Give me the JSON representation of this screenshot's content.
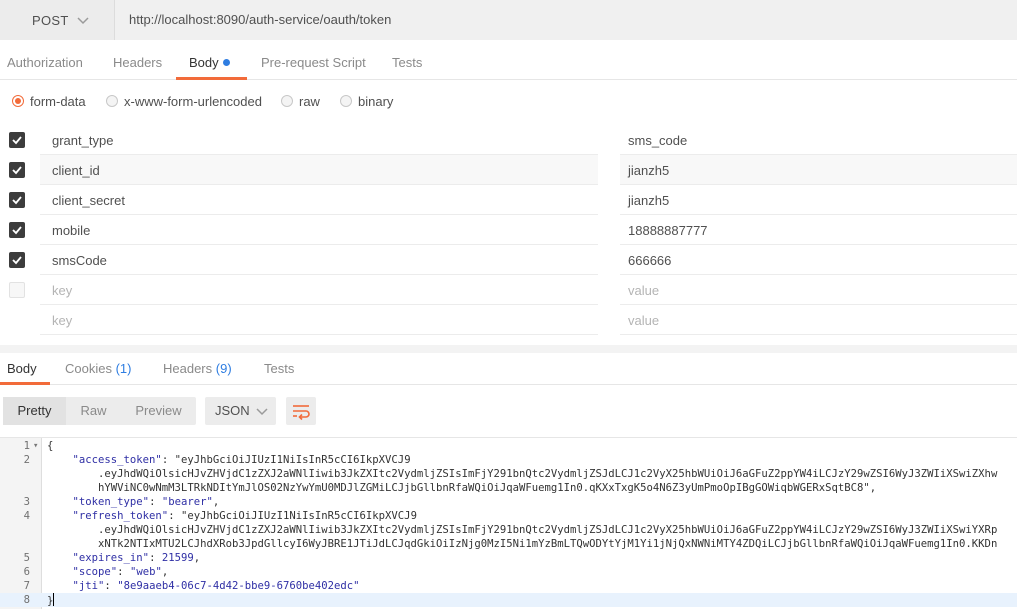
{
  "request": {
    "method": "POST",
    "url": "http://localhost:8090/auth-service/oauth/token"
  },
  "request_tabs": [
    {
      "label": "Authorization"
    },
    {
      "label": "Headers"
    },
    {
      "label": "Body"
    },
    {
      "label": "Pre-request Script"
    },
    {
      "label": "Tests"
    }
  ],
  "body_types": [
    {
      "label": "form-data",
      "checked": true
    },
    {
      "label": "x-www-form-urlencoded",
      "checked": false
    },
    {
      "label": "raw",
      "checked": false
    },
    {
      "label": "binary",
      "checked": false
    }
  ],
  "params": [
    {
      "key": "grant_type",
      "value": "sms_code",
      "checked": true
    },
    {
      "key": "client_id",
      "value": "jianzh5",
      "checked": true
    },
    {
      "key": "client_secret",
      "value": "jianzh5",
      "checked": true
    },
    {
      "key": "mobile",
      "value": "18888887777",
      "checked": true
    },
    {
      "key": "smsCode",
      "value": "666666",
      "checked": true
    }
  ],
  "param_placeholders": {
    "key": "key",
    "value": "value"
  },
  "response_tabs": [
    {
      "label": "Body"
    },
    {
      "label": "Cookies",
      "count": "(1)"
    },
    {
      "label": "Headers",
      "count": "(9)"
    },
    {
      "label": "Tests"
    }
  ],
  "view_modes": [
    "Pretty",
    "Raw",
    "Preview"
  ],
  "format": "JSON",
  "response_lines": [
    {
      "n": "1",
      "text": "{"
    },
    {
      "n": "2",
      "text": "    \"access_token\": \"eyJhbGciOiJIUzI1NiIsInR5cCI6IkpXVCJ9"
    },
    {
      "n": "",
      "text": "        .eyJhdWQiOlsicHJvZHVjdC1zZXJ2aWNlIiwib3JkZXItc2VydmljZSIsImFjY291bnQtc2VydmljZSJdLCJ1c2VyX25hbWUiOiJ6aGFuZ2ppYW4iLCJzY29wZSI6WyJ3ZWIiXSwiZXhw"
    },
    {
      "n": "",
      "text": "        hYWViNC0wNmM3LTRkNDItYmJlOS02NzYwYmU0MDJlZGMiLCJjbGllbnRfaWQiOiJqaWFuemg1In0.qKXxTxgK5o4N6Z3yUmPmoOpIBgGOWiqbWGERxSqtBC8\","
    },
    {
      "n": "3",
      "text": "    \"token_type\": \"bearer\","
    },
    {
      "n": "4",
      "text": "    \"refresh_token\": \"eyJhbGciOiJIUzI1NiIsInR5cCI6IkpXVCJ9"
    },
    {
      "n": "",
      "text": "        .eyJhdWQiOlsicHJvZHVjdC1zZXJ2aWNlIiwib3JkZXItc2VydmljZSIsImFjY291bnQtc2VydmljZSJdLCJ1c2VyX25hbWUiOiJ6aGFuZ2ppYW4iLCJzY29wZSI6WyJ3ZWIiXSwiYXRp"
    },
    {
      "n": "",
      "text": "        xNTk2NTIxMTU2LCJhdXRob3JpdGllcyI6WyJBRE1JTiJdLCJqdGkiOiIzNjg0MzI5Ni1mYzBmLTQwODYtYjM1Yi1jNjQxNWNiMTY4ZDQiLCJjbGllbnRfaWQiOiJqaWFuemg1In0.KKDn"
    },
    {
      "n": "5",
      "text": "    \"expires_in\": 21599,"
    },
    {
      "n": "6",
      "text": "    \"scope\": \"web\","
    },
    {
      "n": "7",
      "text": "    \"jti\": \"8e9aaeb4-06c7-4d42-bbe9-6760be402edc\""
    },
    {
      "n": "8",
      "text": "}"
    }
  ],
  "colors": {
    "accent": "#f26b3a",
    "link": "#2e7de1"
  },
  "icons": {
    "method_dropdown": "chevron-down-icon",
    "format_dropdown": "chevron-down-icon",
    "wrap": "wrap-lines-icon",
    "checkbox": "checkmark-icon"
  }
}
